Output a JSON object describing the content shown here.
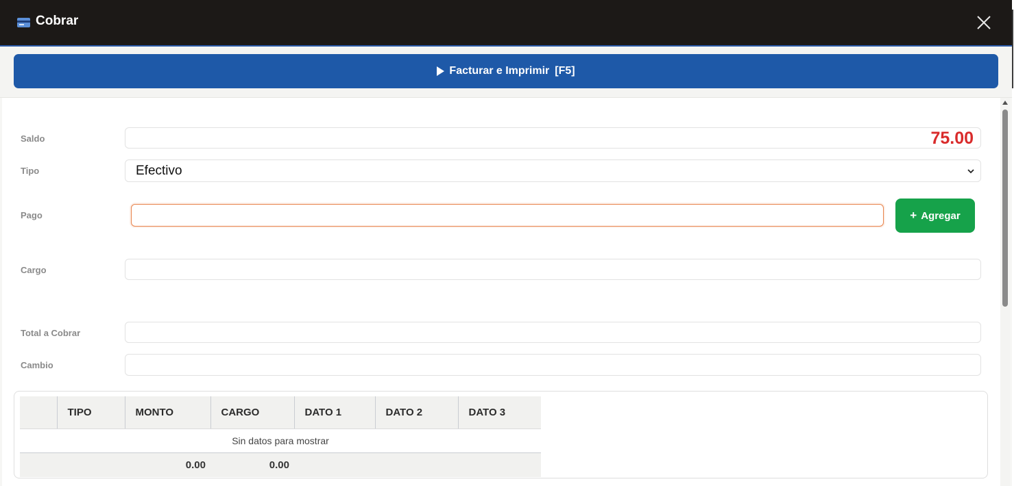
{
  "window": {
    "title": "Cobrar",
    "title_icon": "credit-card-icon",
    "close_icon": "close-icon"
  },
  "action": {
    "label": "Facturar e Imprimir",
    "shortcut": "[F5]",
    "icon": "play-icon"
  },
  "form": {
    "saldo": {
      "label": "Saldo",
      "value": "75.00",
      "value_color": "#d92b2b"
    },
    "tipo": {
      "label": "Tipo",
      "value": "Efectivo"
    },
    "pago": {
      "label": "Pago",
      "value": ""
    },
    "add_button": {
      "label": "Agregar",
      "icon": "plus-icon"
    },
    "cargo": {
      "label": "Cargo",
      "value": ""
    },
    "total": {
      "label": "Total a Cobrar",
      "value": ""
    },
    "cambio": {
      "label": "Cambio",
      "value": ""
    }
  },
  "table": {
    "columns": [
      "",
      "TIPO",
      "MONTO",
      "CARGO",
      "DATO 1",
      "DATO 2",
      "DATO 3"
    ],
    "empty_text": "Sin datos para mostrar",
    "totals": {
      "monto": "0.00",
      "cargo": "0.00"
    }
  },
  "colors": {
    "titlebar": "#1c1917",
    "primary": "#1e59a8",
    "success": "#16a24a",
    "focus_border": "#e8824a"
  }
}
